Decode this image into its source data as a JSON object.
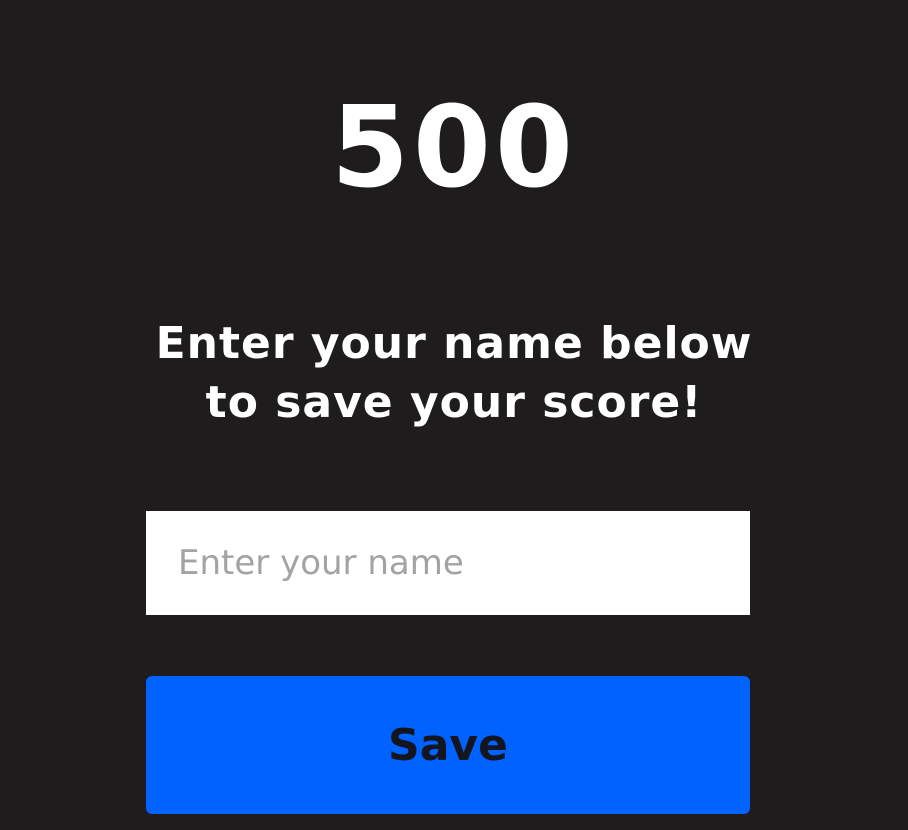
{
  "score": {
    "value": "500"
  },
  "prompt": {
    "text": "Enter your name below to save your score!"
  },
  "name_input": {
    "value": "",
    "placeholder": "Enter your name"
  },
  "save_button": {
    "label": "Save"
  },
  "colors": {
    "background": "#1e1c1d",
    "accent": "#0062ff",
    "text": "#ffffff",
    "placeholder": "#a3a3a3"
  }
}
